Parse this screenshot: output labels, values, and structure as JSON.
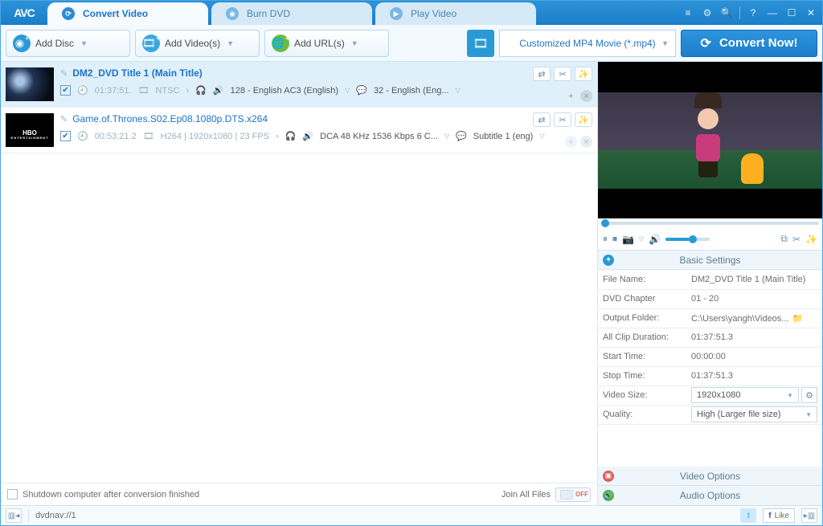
{
  "logo": "AVC",
  "tabs": [
    {
      "label": "Convert Video",
      "active": true
    },
    {
      "label": "Burn DVD",
      "active": false
    },
    {
      "label": "Play Video",
      "active": false
    }
  ],
  "toolbar": {
    "add_disc": "Add Disc",
    "add_videos": "Add Video(s)",
    "add_urls": "Add URL(s)",
    "profile": "Customized MP4 Movie (*.mp4)",
    "convert": "Convert Now!"
  },
  "items": [
    {
      "title": "DM2_DVD Title 1 (Main Title)",
      "selected": true,
      "checked": true,
      "duration": "01:37:51.",
      "codec": "NTSC",
      "audio": "128 - English AC3 (English)",
      "subtitle": "32 - English (Eng..."
    },
    {
      "title": "Game.of.Thrones.S02.Ep08.1080p.DTS.x264",
      "selected": false,
      "checked": true,
      "duration": "00:53:21.2",
      "codec": "H264 | 1920x1080 | 23 FPS",
      "audio": "DCA 48 KHz 1536 Kbps 6 C...",
      "subtitle": "Subtitle 1 (eng)"
    }
  ],
  "left_foot": {
    "shutdown": "Shutdown computer after conversion finished",
    "join": "Join All Files",
    "toggle": "OFF"
  },
  "basic_settings_title": "Basic Settings",
  "settings": {
    "file_name_l": "File Name:",
    "file_name_v": "DM2_DVD Title 1 (Main Title)",
    "dvd_chapter_l": "DVD Chapter",
    "dvd_chapter_v": "01 - 20",
    "output_l": "Output Folder:",
    "output_v": "C:\\Users\\yangh\\Videos...",
    "clip_l": "All Clip Duration:",
    "clip_v": "01:37:51.3",
    "start_l": "Start Time:",
    "start_v": "00:00:00",
    "stop_l": "Stop Time:",
    "stop_v": "01:37:51.3",
    "vsize_l": "Video Size:",
    "vsize_v": "1920x1080",
    "quality_l": "Quality:",
    "quality_v": "High (Larger file size)"
  },
  "video_options": "Video Options",
  "audio_options": "Audio Options",
  "status": {
    "path": "dvdnav://1",
    "like": "Like"
  }
}
